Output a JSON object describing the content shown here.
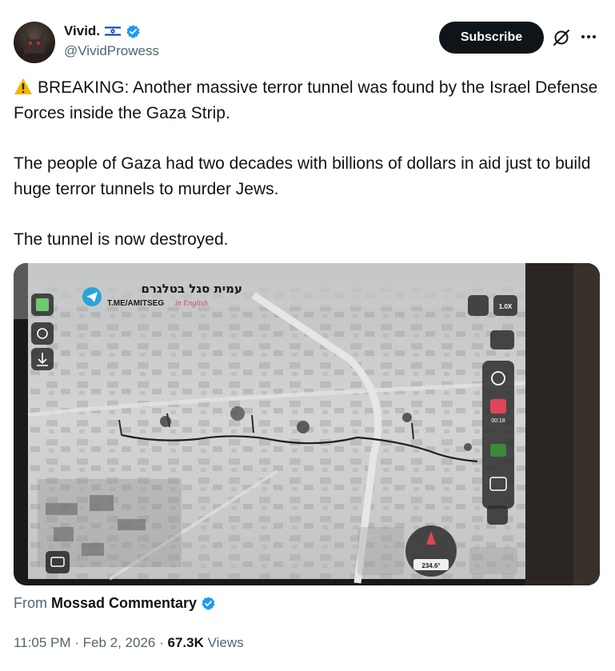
{
  "author": {
    "display_name": "Vivid.",
    "handle": "@VividProwess",
    "flag_icon": "israel-flag-icon",
    "verified_color": "#1d9bf0"
  },
  "actions": {
    "subscribe_label": "Subscribe"
  },
  "tweet": {
    "paragraphs": [
      "BREAKING: Another massive terror tunnel was found by the Israel Defense Forces inside the Gaza Strip.",
      "The people of Gaza had two decades with billions of dollars in aid just to build huge terror tunnels to murder Jews.",
      "The tunnel is now destroyed."
    ],
    "warning_icon": "warning-icon"
  },
  "video_overlay": {
    "channel_hebrew": "עמית סגל בטלגרם",
    "channel_link": "T.ME/AMITSEG",
    "channel_suffix": "in English",
    "zoom": "1.0X",
    "time_readout": "00:18",
    "heading": "234.6°"
  },
  "source": {
    "prefix": "From",
    "name": "Mossad Commentary"
  },
  "meta": {
    "time": "11:05 PM",
    "date": "Feb 2, 2026",
    "views_count": "67.3K",
    "views_label": "Views"
  },
  "colors": {
    "accent": "#1d9bf0",
    "text": "#0f1419",
    "muted": "#536471",
    "button_bg": "#0f1419"
  }
}
